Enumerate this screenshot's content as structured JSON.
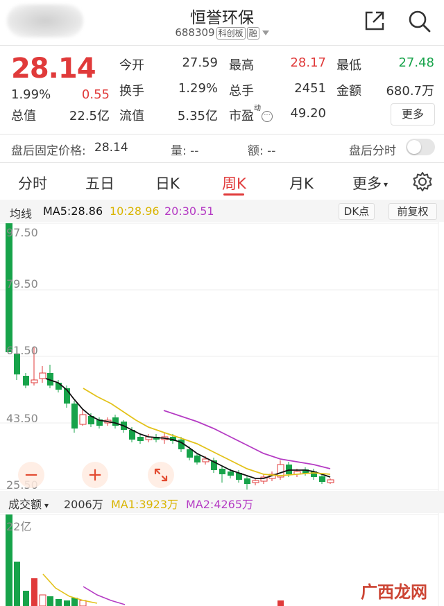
{
  "header": {
    "title": "恒誉环保",
    "code": "688309",
    "tag1": "科创板",
    "tag2": "融"
  },
  "quote": {
    "price": "28.14",
    "change_pct": "1.99%",
    "change": "0.55",
    "labels": {
      "open": "今开",
      "high": "最高",
      "low": "最低",
      "turnover": "换手",
      "total_shares": "总手",
      "amount": "金额",
      "market_cap": "总值",
      "float_cap": "流值",
      "pe": "市盈",
      "pe_sup": "动"
    },
    "values": {
      "open": "27.59",
      "high": "28.17",
      "low": "27.48",
      "turnover": "1.29%",
      "total_shares": "2451",
      "amount": "680.7万",
      "market_cap": "22.5亿",
      "float_cap": "5.35亿",
      "pe": "49.20"
    },
    "more_label": "更多"
  },
  "afterhours": {
    "label": "盘后固定价格:",
    "price": "28.14",
    "volume_label": "量: --",
    "amount_label": "额: --",
    "toggle_label": "盘后分时"
  },
  "tabs": [
    "分时",
    "五日",
    "日K",
    "周K",
    "月K",
    "更多"
  ],
  "active_tab": "周K",
  "ma": {
    "label": "均线",
    "ma5": "MA5:28.86",
    "ma10": "10:28.96",
    "ma20": "20:30.51",
    "dk_label": "DK点",
    "adjust_label": "前复权"
  },
  "axis": {
    "y_labels": [
      "97.50",
      "79.50",
      "61.50",
      "43.50",
      "25.50"
    ]
  },
  "volume": {
    "label": "成交额",
    "value": "2006万",
    "ma1": "MA1:3923万",
    "ma2": "MA2:4265万",
    "axis_top": "22亿"
  },
  "watermark": "广西龙网",
  "colors": {
    "up": "#e03a3a",
    "down": "#17a34a",
    "ma5": "#111111",
    "ma10": "#e3c21a",
    "ma20": "#b53cc4"
  }
}
